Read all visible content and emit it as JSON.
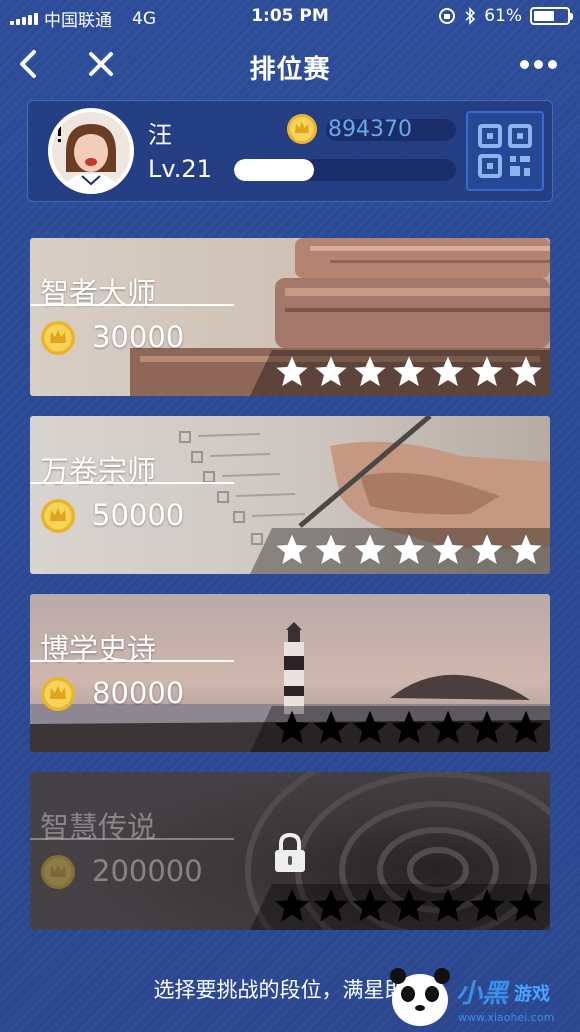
{
  "status_bar": {
    "carrier": "中国联通",
    "network": "4G",
    "time": "1:05 PM",
    "battery": "61%",
    "battery_level": 0.61
  },
  "nav": {
    "title": "排位赛"
  },
  "profile": {
    "name": "汪",
    "level": "Lv.21",
    "coins": "894370",
    "xp_progress": 0.36
  },
  "ranks": [
    {
      "name": "智者大师",
      "cost": "30000",
      "stars_filled": 7,
      "stars_total": 7,
      "locked": false
    },
    {
      "name": "万卷宗师",
      "cost": "50000",
      "stars_filled": 7,
      "stars_total": 7,
      "locked": false
    },
    {
      "name": "博学史诗",
      "cost": "80000",
      "stars_filled": 0,
      "stars_total": 7,
      "locked": false
    },
    {
      "name": "智慧传说",
      "cost": "200000",
      "stars_filled": 0,
      "stars_total": 7,
      "locked": true
    }
  ],
  "footer": {
    "hint": "选择要挑战的段位，满星即可"
  },
  "colors": {
    "background": "#2b4a94",
    "coin_value": "#6aa7e6",
    "star_filled": "#ffffff",
    "star_empty": "#000000"
  },
  "watermark": {
    "text": "小黑游戏",
    "url": "www.xiaohei.com"
  }
}
